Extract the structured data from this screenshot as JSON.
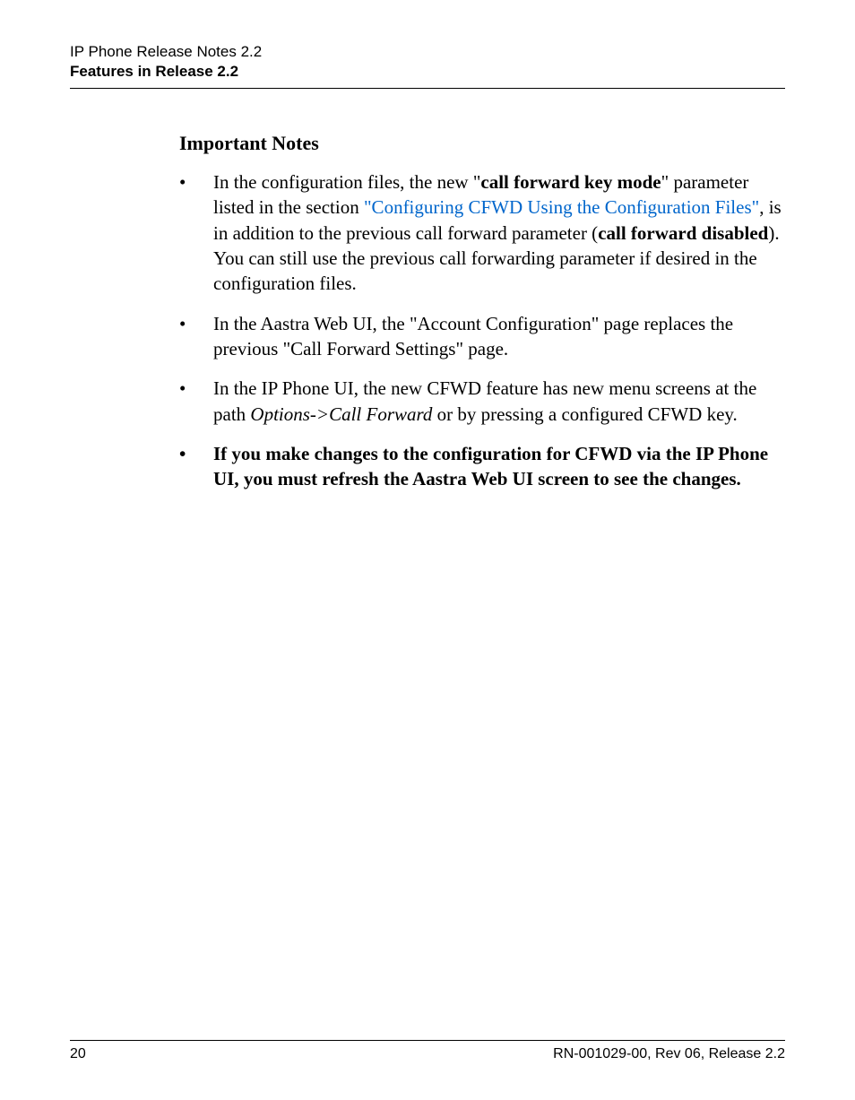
{
  "header": {
    "line1": "IP Phone Release Notes 2.2",
    "line2": "Features in Release 2.2"
  },
  "section_title": "Important Notes",
  "bullets": {
    "item1": {
      "pre": "In the configuration files, the new \"",
      "bold1": "call forward key mode",
      "mid1": "\" parameter listed in the section ",
      "link": "\"Configuring CFWD Using the Configuration Files\"",
      "mid2": ", is in addition to the previous call forward parameter (",
      "bold2": "call forward disabled",
      "post": "). You can still use the previous call forwarding parameter if desired in the configuration files."
    },
    "item2": "In the Aastra Web UI, the \"Account Configuration\" page replaces the previous \"Call Forward Settings\" page.",
    "item3": {
      "pre": "In the IP Phone UI, the new CFWD feature has new menu screens at the path ",
      "italic": "Options->Call Forward",
      "post": " or by pressing a configured CFWD key."
    },
    "item4": "If you make changes to the configuration for CFWD via the IP Phone UI, you must refresh the Aastra Web UI screen to see the changes."
  },
  "footer": {
    "page": "20",
    "doc": "RN-001029-00, Rev 06, Release 2.2"
  }
}
